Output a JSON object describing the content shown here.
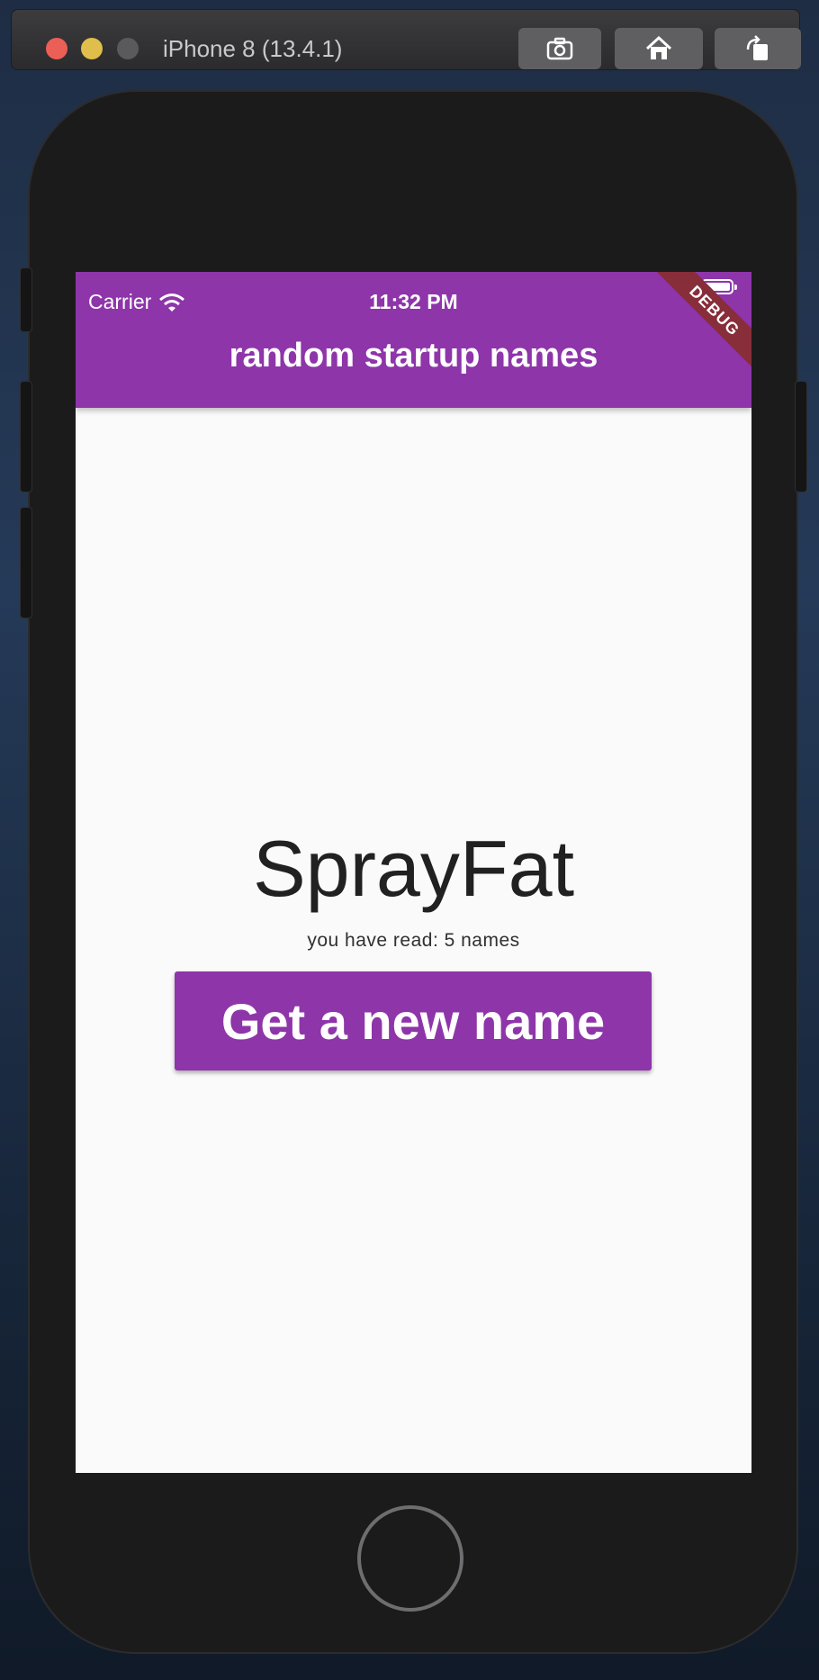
{
  "simulator": {
    "title": "iPhone 8 (13.4.1)",
    "toolbar_icons": [
      "camera-icon",
      "home-icon",
      "rotate-icon"
    ]
  },
  "status_bar": {
    "carrier": "Carrier",
    "time": "11:32 PM",
    "battery_level": 1.0
  },
  "appbar": {
    "title": "random startup names",
    "debug_banner": "DEBUG"
  },
  "main": {
    "startup_name": "SprayFat",
    "read_count": "you have read: 5 names",
    "new_name_button": "Get a new name"
  },
  "colors": {
    "primary": "#8e35aa",
    "debug_banner": "#882d3a",
    "screen_background": "#fafafa",
    "text": "#212121"
  }
}
